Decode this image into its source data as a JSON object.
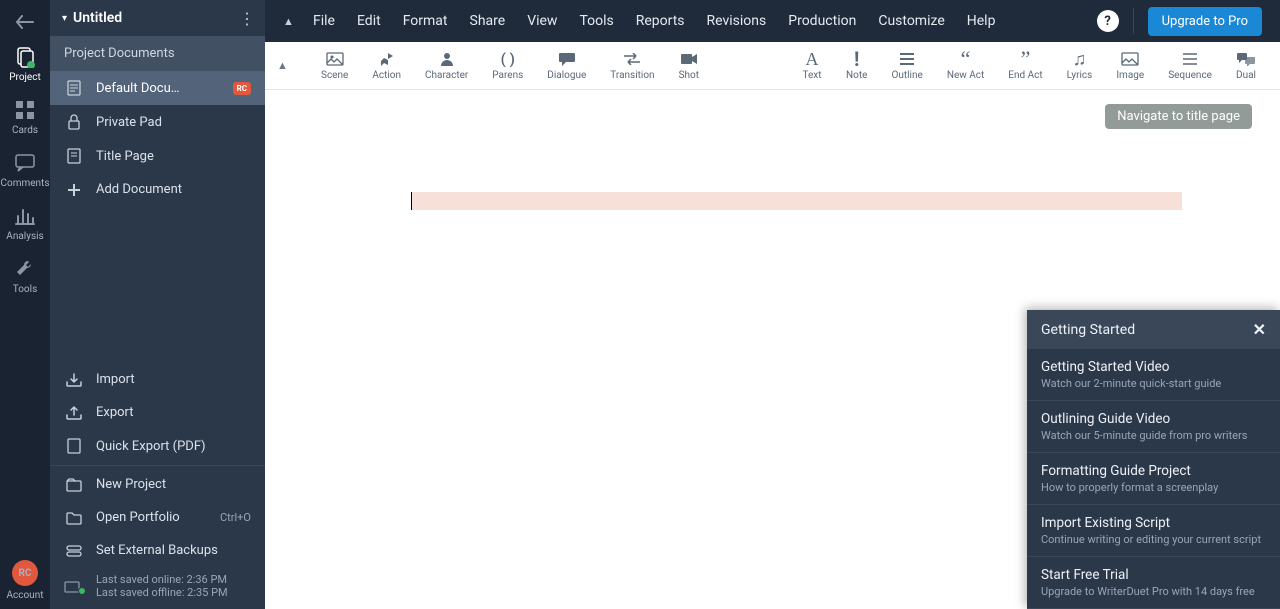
{
  "rail": {
    "items": [
      {
        "label": "Project"
      },
      {
        "label": "Cards"
      },
      {
        "label": "Comments"
      },
      {
        "label": "Analysis"
      },
      {
        "label": "Tools"
      }
    ],
    "account": {
      "initials": "RC",
      "label": "Account"
    }
  },
  "panel": {
    "title": "Untitled",
    "group_label": "Project Documents",
    "docs": [
      {
        "label": "Default Docu…",
        "badge": "RC"
      },
      {
        "label": "Private Pad"
      },
      {
        "label": "Title Page"
      },
      {
        "label": "Add Document"
      }
    ],
    "actions": [
      {
        "label": "Import"
      },
      {
        "label": "Export"
      },
      {
        "label": "Quick Export (PDF)"
      },
      {
        "label": "New Project"
      },
      {
        "label": "Open Portfolio",
        "shortcut": "Ctrl+O"
      },
      {
        "label": "Set External Backups"
      }
    ],
    "save": {
      "line1": "Last saved online: 2:36 PM",
      "line2": "Last saved offline: 2:35 PM"
    }
  },
  "menu": {
    "items": [
      "File",
      "Edit",
      "Format",
      "Share",
      "View",
      "Tools",
      "Reports",
      "Revisions",
      "Production",
      "Customize",
      "Help"
    ],
    "upgrade": "Upgrade to Pro"
  },
  "toolbar": {
    "items": [
      "Scene",
      "Action",
      "Character",
      "Parens",
      "Dialogue",
      "Transition",
      "Shot",
      "Text",
      "Note",
      "Outline",
      "New Act",
      "End Act",
      "Lyrics",
      "Image",
      "Sequence",
      "Dual"
    ]
  },
  "tooltip": "Navigate to title page",
  "gs": {
    "title": "Getting Started",
    "items": [
      {
        "t": "Getting Started Video",
        "d": "Watch our 2-minute quick-start guide"
      },
      {
        "t": "Outlining Guide Video",
        "d": "Watch our 5-minute guide from pro writers"
      },
      {
        "t": "Formatting Guide Project",
        "d": "How to properly format a screenplay"
      },
      {
        "t": "Import Existing Script",
        "d": "Continue writing or editing your current script"
      },
      {
        "t": "Start Free Trial",
        "d": "Upgrade to WriterDuet Pro with 14 days free"
      }
    ]
  }
}
